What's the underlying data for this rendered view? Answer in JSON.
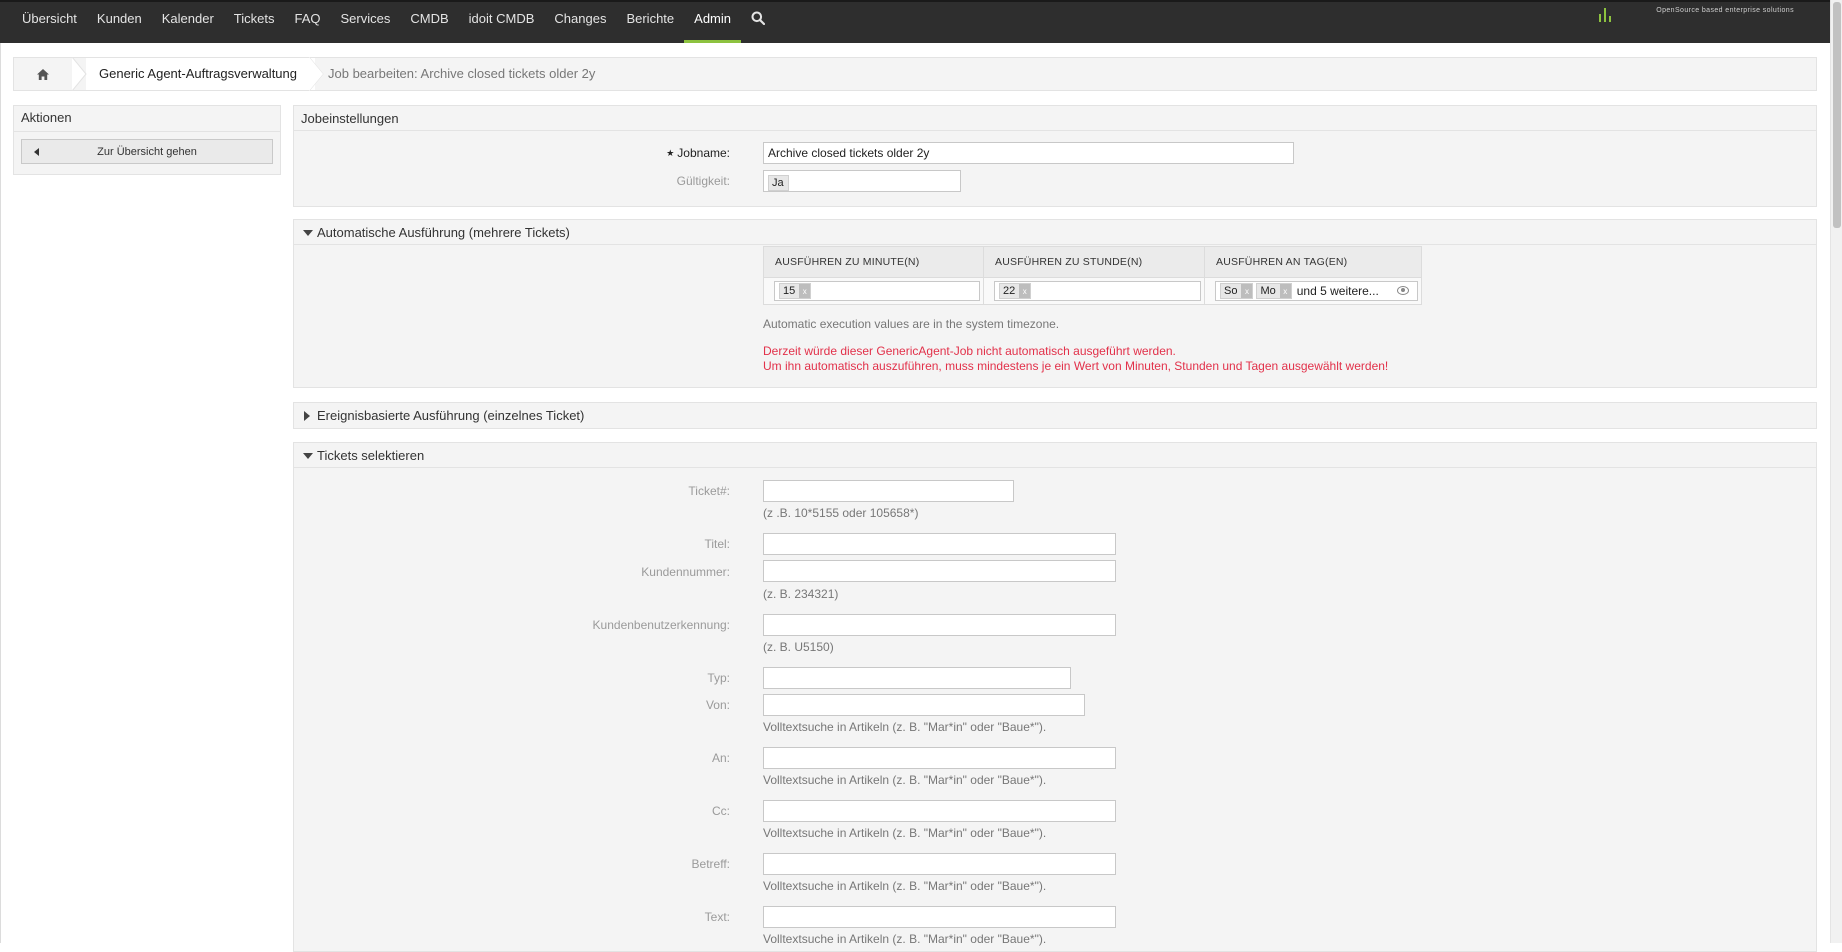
{
  "nav": {
    "items": [
      "Übersicht",
      "Kunden",
      "Kalender",
      "Tickets",
      "FAQ",
      "Services",
      "CMDB",
      "idoit CMDB",
      "Changes",
      "Berichte",
      "Admin"
    ],
    "active": "Admin",
    "search_icon": "search-icon"
  },
  "logo": {
    "tagline": "OpenSource based enterprise solutions"
  },
  "breadcrumb": {
    "home_icon": "home-icon",
    "item1": "Generic Agent-Auftragsverwaltung",
    "item2": "Job bearbeiten: Archive closed tickets older 2y"
  },
  "sidebar": {
    "title": "Aktionen",
    "back_button": "Zur Übersicht gehen"
  },
  "job_settings": {
    "title": "Jobeinstellungen",
    "jobname_label": "Jobname:",
    "jobname_value": "Archive closed tickets older 2y",
    "validity_label": "Gültigkeit:",
    "validity_value": "Ja"
  },
  "auto_exec": {
    "title": "Automatische Ausführung (mehrere Tickets)",
    "col_minute": "AUSFÜHREN ZU MINUTE(N)",
    "col_hour": "AUSFÜHREN ZU STUNDE(N)",
    "col_day": "AUSFÜHREN AN TAG(EN)",
    "minute_value": "15",
    "hour_value": "22",
    "day_values": [
      "So",
      "Mo"
    ],
    "day_more": "und 5 weitere...",
    "tag_remove": "x",
    "timezone_note": "Automatic execution values are in the system timezone.",
    "warning_line1": "Derzeit würde dieser GenericAgent-Job nicht automatisch ausgeführt werden.",
    "warning_line2": "Um ihn automatisch auszuführen, muss mindestens je ein Wert von Minuten, Stunden und Tagen ausgewählt werden!"
  },
  "event_exec": {
    "title": "Ereignisbasierte Ausführung (einzelnes Ticket)"
  },
  "ticket_select": {
    "title": "Tickets selektieren",
    "ticketnr_label": "Ticket#:",
    "ticketnr_hint": "(z .B. 10*5155 oder 105658*)",
    "title_label": "Titel:",
    "customer_nr_label": "Kundennummer:",
    "customer_nr_hint": "(z. B. 234321)",
    "customer_user_label": "Kundenbenutzerkennung:",
    "customer_user_hint": "(z. B. U5150)",
    "type_label": "Typ:",
    "from_label": "Von:",
    "to_label": "An:",
    "cc_label": "Cc:",
    "subject_label": "Betreff:",
    "text_label": "Text:",
    "fulltext_hint": "Volltextsuche in Artikeln (z. B. \"Mar*in\" oder \"Baue*\")."
  }
}
